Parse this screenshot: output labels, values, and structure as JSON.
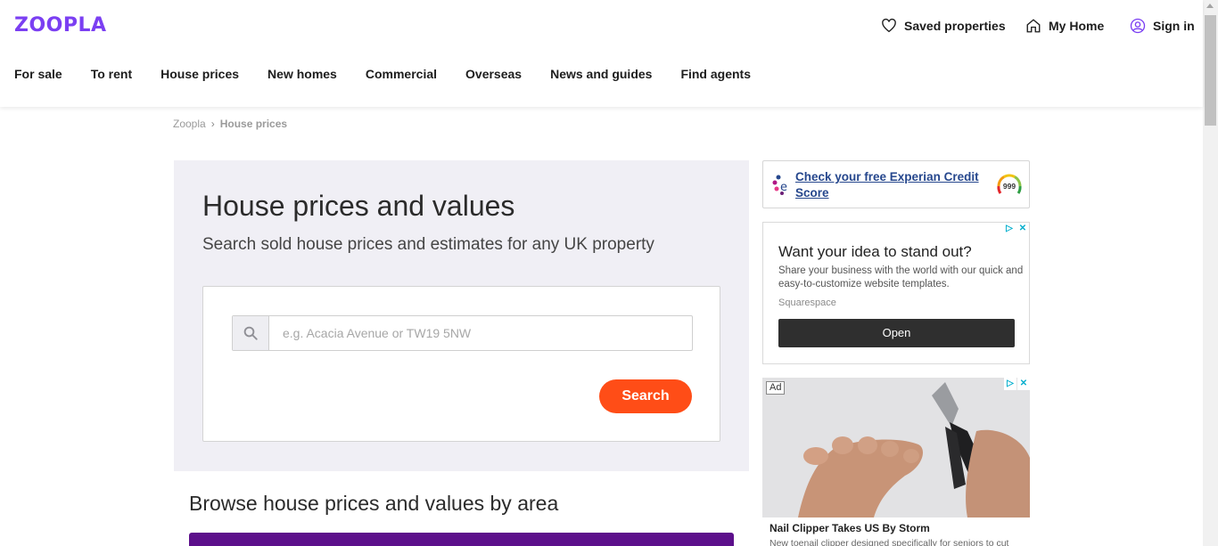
{
  "header": {
    "logo": "ZOOPLA",
    "saved_label": "Saved properties",
    "myhome_label": "My Home",
    "signin_label": "Sign in"
  },
  "nav": [
    "For sale",
    "To rent",
    "House prices",
    "New homes",
    "Commercial",
    "Overseas",
    "News and guides",
    "Find agents"
  ],
  "breadcrumb": {
    "root": "Zoopla",
    "current": "House prices"
  },
  "hero": {
    "title": "House prices and values",
    "subtitle": "Search sold house prices and estimates for any UK property",
    "search_placeholder": "e.g. Acacia Avenue or TW19 5NW",
    "search_button": "Search"
  },
  "browse_title": "Browse house prices and values by area",
  "experian": {
    "link_text": "Check your free Experian Credit Score",
    "gauge_value": "999"
  },
  "ad1": {
    "headline": "Want your idea to stand out?",
    "body": "Share your business with the world with our quick and easy-to-customize website templates.",
    "advertiser": "Squarespace",
    "cta": "Open"
  },
  "ad2": {
    "label": "Ad",
    "caption": "Nail Clipper Takes US By Storm",
    "desc": "New toenail clipper designed specifically for seniors to cut"
  },
  "colors": {
    "brand": "#7b3ff2",
    "search_button": "#ff4d17",
    "hero_bg": "#f0eff5",
    "purple_bar": "#5c0f8b"
  }
}
